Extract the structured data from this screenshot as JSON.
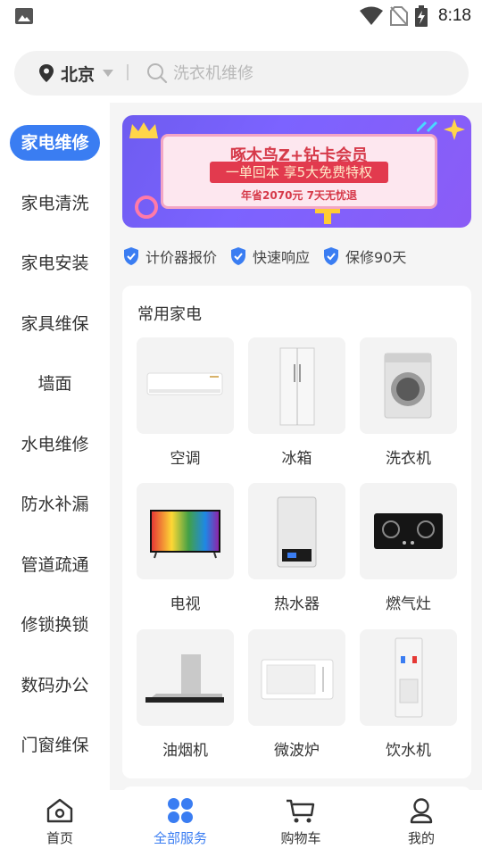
{
  "status_bar": {
    "time": "8:18"
  },
  "search": {
    "city": "北京",
    "placeholder": "洗衣机维修"
  },
  "sidebar": {
    "items": [
      {
        "label": "家电维修",
        "active": true
      },
      {
        "label": "家电清洗"
      },
      {
        "label": "家电安装"
      },
      {
        "label": "家具维保"
      },
      {
        "label": "墙面"
      },
      {
        "label": "水电维修"
      },
      {
        "label": "防水补漏"
      },
      {
        "label": "管道疏通"
      },
      {
        "label": "修锁换锁"
      },
      {
        "label": "数码办公"
      },
      {
        "label": "门窗维保"
      }
    ]
  },
  "banner": {
    "title": "啄木鸟Z+钻卡会员",
    "ribbon": "一单回本 享5大免费特权",
    "subtitle": "年省2070元 7天无忧退"
  },
  "features": [
    {
      "label": "计价器报价"
    },
    {
      "label": "快速响应"
    },
    {
      "label": "保修90天"
    }
  ],
  "appliances": {
    "title": "常用家电",
    "items": [
      {
        "label": "空调"
      },
      {
        "label": "冰箱"
      },
      {
        "label": "洗衣机"
      },
      {
        "label": "电视"
      },
      {
        "label": "热水器"
      },
      {
        "label": "燃气灶"
      },
      {
        "label": "油烟机"
      },
      {
        "label": "微波炉"
      },
      {
        "label": "饮水机"
      }
    ]
  },
  "bottom_nav": {
    "items": [
      {
        "label": "首页"
      },
      {
        "label": "全部服务",
        "active": true
      },
      {
        "label": "购物车"
      },
      {
        "label": "我的"
      }
    ]
  },
  "colors": {
    "accent": "#3a7df2",
    "banner_red": "#e23a4e",
    "banner_purple": "#7c63ff"
  }
}
